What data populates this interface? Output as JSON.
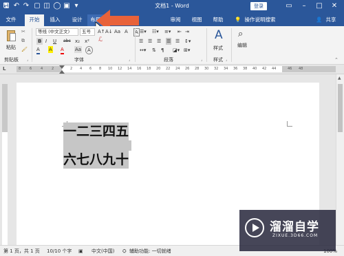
{
  "window": {
    "title": "文档1 - Word",
    "login_label": "登录",
    "controls": {
      "restore": "▭",
      "minimize": "–",
      "maximize": "□",
      "close": "✕"
    }
  },
  "quick_access": {
    "icons": [
      "word-logo-icon",
      "save-icon",
      "undo-icon",
      "redo-icon",
      "new-doc-icon",
      "open-icon",
      "circle-icon",
      "print-icon",
      "more-icon"
    ]
  },
  "tabs": [
    {
      "label": "文件"
    },
    {
      "label": "开始"
    },
    {
      "label": "插入"
    },
    {
      "label": "设计"
    },
    {
      "label": "布局"
    },
    {
      "label": "审阅"
    },
    {
      "label": "视图"
    },
    {
      "label": "帮助"
    }
  ],
  "tell_me": {
    "label": "操作说明搜索"
  },
  "share": {
    "label": "共享"
  },
  "ribbon": {
    "clipboard": {
      "paste_label": "粘贴",
      "group_label": "剪贴板"
    },
    "font": {
      "font_name": "等线 (中文正文)",
      "font_size": "五号",
      "group_label": "字体",
      "buttons": [
        "B",
        "I",
        "U",
        "abc",
        "x₂",
        "x²"
      ],
      "row3": [
        "A",
        "A",
        "A",
        "Aa",
        "A"
      ]
    },
    "paragraph": {
      "group_label": "段落"
    },
    "styles": {
      "label": "样式",
      "group_label": "样式"
    },
    "editing": {
      "label": "编辑"
    }
  },
  "ruler": {
    "left_marker": "L",
    "numbers": [
      "8",
      "6",
      "4",
      "2",
      "2",
      "4",
      "6",
      "8",
      "10",
      "12",
      "14",
      "16",
      "18",
      "20",
      "22",
      "24",
      "26",
      "28",
      "30",
      "32",
      "34",
      "36",
      "38",
      "40",
      "42",
      "44",
      "46",
      "48"
    ]
  },
  "document": {
    "lines": [
      "一二三四五",
      "六七八九十"
    ]
  },
  "statusbar": {
    "page": "第 1 页，共 1 页",
    "words": "10/10 个字",
    "language": "中文(中国)",
    "accessibility": "辅助功能: 一切就绪",
    "zoom": "100%"
  },
  "watermark": {
    "brand": "溜溜自学",
    "url": "ZIXUE.3D66.COM"
  },
  "colors": {
    "word_blue": "#2b579a",
    "ribbon_bg": "#f3f3f3",
    "highlight": "#c6c6c6",
    "arrow": "#e8623a"
  }
}
